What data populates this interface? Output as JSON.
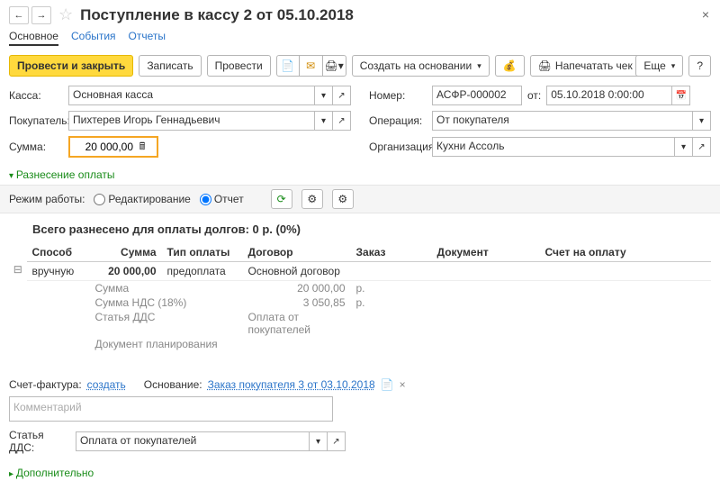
{
  "header": {
    "title": "Поступление в кассу 2 от 05.10.2018"
  },
  "tabs": {
    "main": "Основное",
    "events": "События",
    "reports": "Отчеты"
  },
  "toolbar": {
    "post_close": "Провести и закрыть",
    "save": "Записать",
    "post": "Провести",
    "create_based": "Создать на основании",
    "print_check": "Напечатать чек",
    "more": "Еще",
    "help": "?"
  },
  "form": {
    "kassa_label": "Касса:",
    "kassa_value": "Основная касса",
    "number_label": "Номер:",
    "number_value": "АСФР-000002",
    "from_label": "от:",
    "date_value": "05.10.2018 0:00:00",
    "buyer_label": "Покупатель:",
    "buyer_value": "Пихтерев Игорь Геннадьевич",
    "operation_label": "Операция:",
    "operation_value": "От покупателя",
    "sum_label": "Сумма:",
    "sum_value": "20 000,00",
    "org_label": "Организация:",
    "org_value": "Кухни Ассоль"
  },
  "section": {
    "allocation": "Разнесение оплаты",
    "mode_label": "Режим работы:",
    "mode_edit": "Редактирование",
    "mode_report": "Отчет"
  },
  "summary": "Всего разнесено для оплаты долгов: 0 р. (0%)",
  "table": {
    "headers": {
      "method": "Способ",
      "sum": "Сумма",
      "pay_type": "Тип оплаты",
      "contract": "Договор",
      "order": "Заказ",
      "document": "Документ",
      "invoice": "Счет на оплату"
    },
    "row": {
      "method": "вручную",
      "sum": "20 000,00",
      "pay_type": "предоплата",
      "contract": "Основной договор"
    },
    "sub": {
      "sum_label": "Сумма",
      "sum_value": "20 000,00",
      "cur": "р.",
      "vat_label": "Сумма НДС (18%)",
      "vat_value": "3 050,85",
      "dds_label": "Статья ДДС",
      "dds_value": "Оплата от покупателей",
      "plan_label": "Документ планирования"
    }
  },
  "footer": {
    "invoice_label": "Счет-фактура:",
    "create_link": "создать",
    "basis_label": "Основание:",
    "basis_link": "Заказ покупателя 3 от 03.10.2018",
    "comment_placeholder": "Комментарий",
    "dds_label": "Статья ДДС:",
    "dds_value": "Оплата от покупателей",
    "additional": "Дополнительно"
  }
}
